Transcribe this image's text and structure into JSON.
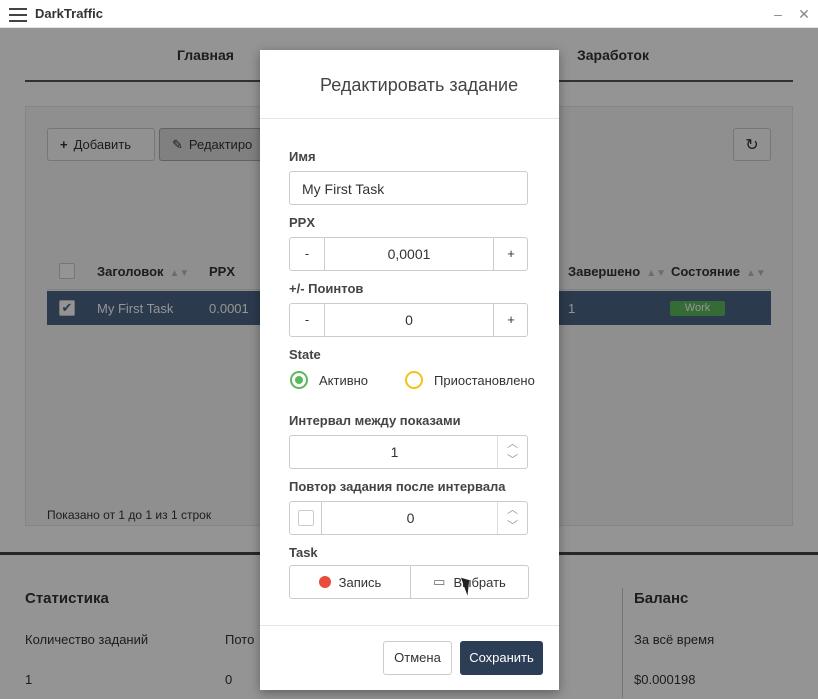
{
  "window": {
    "title": "DarkTraffic",
    "minimize": "‒",
    "close": "✕"
  },
  "tabs": [
    "Главная",
    "Заработок"
  ],
  "toolbar": {
    "add": "Добавить",
    "edit": "Редактиро",
    "refresh_icon": "↻"
  },
  "table": {
    "headers": [
      "Заголовок",
      "PPX",
      "Завершено",
      "Состояние"
    ],
    "rows": [
      {
        "title": "My First Task",
        "ppx": "0.0001",
        "completed": "1",
        "state": "Work"
      }
    ],
    "footer": "Показано от 1 до 1 из 1 строк"
  },
  "stats": {
    "title": "Статистика",
    "count_label": "Количество заданий",
    "count_value": "1",
    "flow_label": "Пото",
    "flow_value": "0",
    "balance_title": "Баланс",
    "balance_label": "За всё время",
    "balance_value": "$0.000198"
  },
  "modal": {
    "title": "Редактировать задание",
    "name_label": "Имя",
    "name_value": "My First Task",
    "ppx_label": "PPX",
    "ppx_value": "0,0001",
    "points_label": "+/- Поинтов",
    "points_value": "0",
    "minus": "-",
    "plus": "+",
    "state_label": "State",
    "state_active": "Активно",
    "state_paused": "Приостановлено",
    "interval_label": "Интервал между показами",
    "interval_value": "1",
    "repeat_label": "Повтор задания после интервала",
    "repeat_value": "0",
    "task_label": "Task",
    "record": "Запись",
    "choose": "Выбрать",
    "cancel": "Отмена",
    "save": "Сохранить"
  },
  "colors": {
    "accent_dark": "#2c3e55",
    "active_green": "#5cb85c",
    "paused_yellow": "#f0c419",
    "record_red": "#e74c3c"
  }
}
